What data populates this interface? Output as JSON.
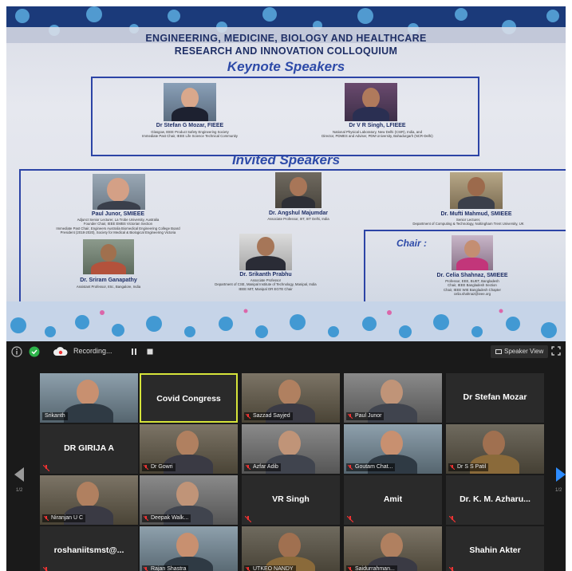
{
  "poster": {
    "title_line1": "ENGINEERING, MEDICINE, BIOLOGY AND HEALTHCARE",
    "title_line2": "RESEARCH AND INNOVATION COLLOQUIUM",
    "keynote_heading": "Keynote Speakers",
    "invited_heading": "Invited Speakers",
    "chair_heading": "Chair :",
    "keynote": [
      {
        "name": "Dr Stefan G Mozar, FIEEE",
        "desc1": "Glasgow, IEEE Product Safety Engineering Society",
        "desc2": "Immediate Past Chair, IEEE Life Science Technical Community"
      },
      {
        "name": "Dr V R Singh, LFIEEE",
        "desc1": "National Physical Laboratory, New Delhi (CSIR), India, and",
        "desc2": "Director, PDMES and Adviser, PDM University, Bahadurgarh (NCR-Delhi)"
      }
    ],
    "invited": [
      {
        "name": "Paul Junor, SMIEEE",
        "desc1": "Adjunct Senior Lecturer, La Trobe University, Australia",
        "desc2": "Founder Chair, IEEE EMBS Victorian Section",
        "desc3": "Immediate Past Chair, Engineers Australia Biomedical Engineering College Board",
        "desc4": "President (2018-2020), Society for Medical & Biological Engineering Victoria"
      },
      {
        "name": "Dr. Angshul Majumdar",
        "desc1": "Associate Professor, IIIT, IIIT Delhi, India"
      },
      {
        "name": "Dr. Mufti Mahmud, SMIEEE",
        "desc1": "Senior Lecturer,",
        "desc2": "Department of Computing & Technology, Nottingham Trent University, UK"
      },
      {
        "name": "Dr. Sriram Ganapathy",
        "desc1": "Assistant Professor, IISc, Bangalore, India"
      },
      {
        "name": "Dr. Srikanth Prabhu",
        "desc1": "Associate Professor",
        "desc2": "Department of CSE, Manipal Institute of Technology, Manipal, India",
        "desc3": "IEEE MIT, Manipal OR EGTE Chair"
      }
    ],
    "chair": {
      "name": "Dr. Celia Shahnaz, SMIEEE",
      "desc1": "Professor, EEE, BUET, Bangladesh",
      "desc2": "Chair, IEEE Bangladesh Section",
      "desc3": "Chair, IEEE WIE Bangladesh Chapter",
      "desc4": "celia.shahnaz@ieee.org"
    }
  },
  "meeting": {
    "recording_label": "Recording...",
    "speaker_view_label": "Speaker View",
    "page_left": "1/2",
    "page_right": "1/2",
    "tiles": [
      {
        "label": "Srikanth",
        "center": "",
        "video": true,
        "muted": false,
        "active": false
      },
      {
        "label": "",
        "center": "Covid Congress",
        "video": false,
        "muted": false,
        "active": true
      },
      {
        "label": "Sazzad Sayjed",
        "center": "",
        "video": true,
        "muted": true,
        "active": false
      },
      {
        "label": "Paul Junor",
        "center": "",
        "video": true,
        "muted": true,
        "active": false
      },
      {
        "label": "",
        "center": "Dr Stefan Mozar",
        "video": false,
        "muted": false,
        "active": false
      },
      {
        "label": "",
        "center": "DR GIRIJA A",
        "video": false,
        "muted": true,
        "active": false
      },
      {
        "label": "Dr Gowri",
        "center": "",
        "video": true,
        "muted": true,
        "active": false
      },
      {
        "label": "Azfar Adib",
        "center": "",
        "video": true,
        "muted": true,
        "active": false
      },
      {
        "label": "Goutam Chat...",
        "center": "",
        "video": true,
        "muted": true,
        "active": false
      },
      {
        "label": "Dr S S Patil",
        "center": "",
        "video": true,
        "muted": true,
        "active": false
      },
      {
        "label": "Niranjan U C",
        "center": "",
        "video": true,
        "muted": true,
        "active": false
      },
      {
        "label": "Deepak Walk...",
        "center": "",
        "video": true,
        "muted": true,
        "active": false
      },
      {
        "label": "",
        "center": "VR Singh",
        "video": false,
        "muted": true,
        "active": false
      },
      {
        "label": "",
        "center": "Amit",
        "video": false,
        "muted": true,
        "active": false
      },
      {
        "label": "",
        "center": "Dr. K. M. Azharu...",
        "video": false,
        "muted": true,
        "active": false
      },
      {
        "label": "",
        "center": "roshaniitsmst@...",
        "video": false,
        "muted": true,
        "active": false
      },
      {
        "label": "Rajan Shastra",
        "center": "",
        "video": true,
        "muted": true,
        "active": false
      },
      {
        "label": "UTKEO NANDY",
        "center": "",
        "video": true,
        "muted": true,
        "active": false
      },
      {
        "label": "Saidurrahman...",
        "center": "",
        "video": true,
        "muted": true,
        "active": false
      },
      {
        "label": "",
        "center": "Shahin Akter",
        "video": false,
        "muted": true,
        "active": false
      }
    ]
  }
}
